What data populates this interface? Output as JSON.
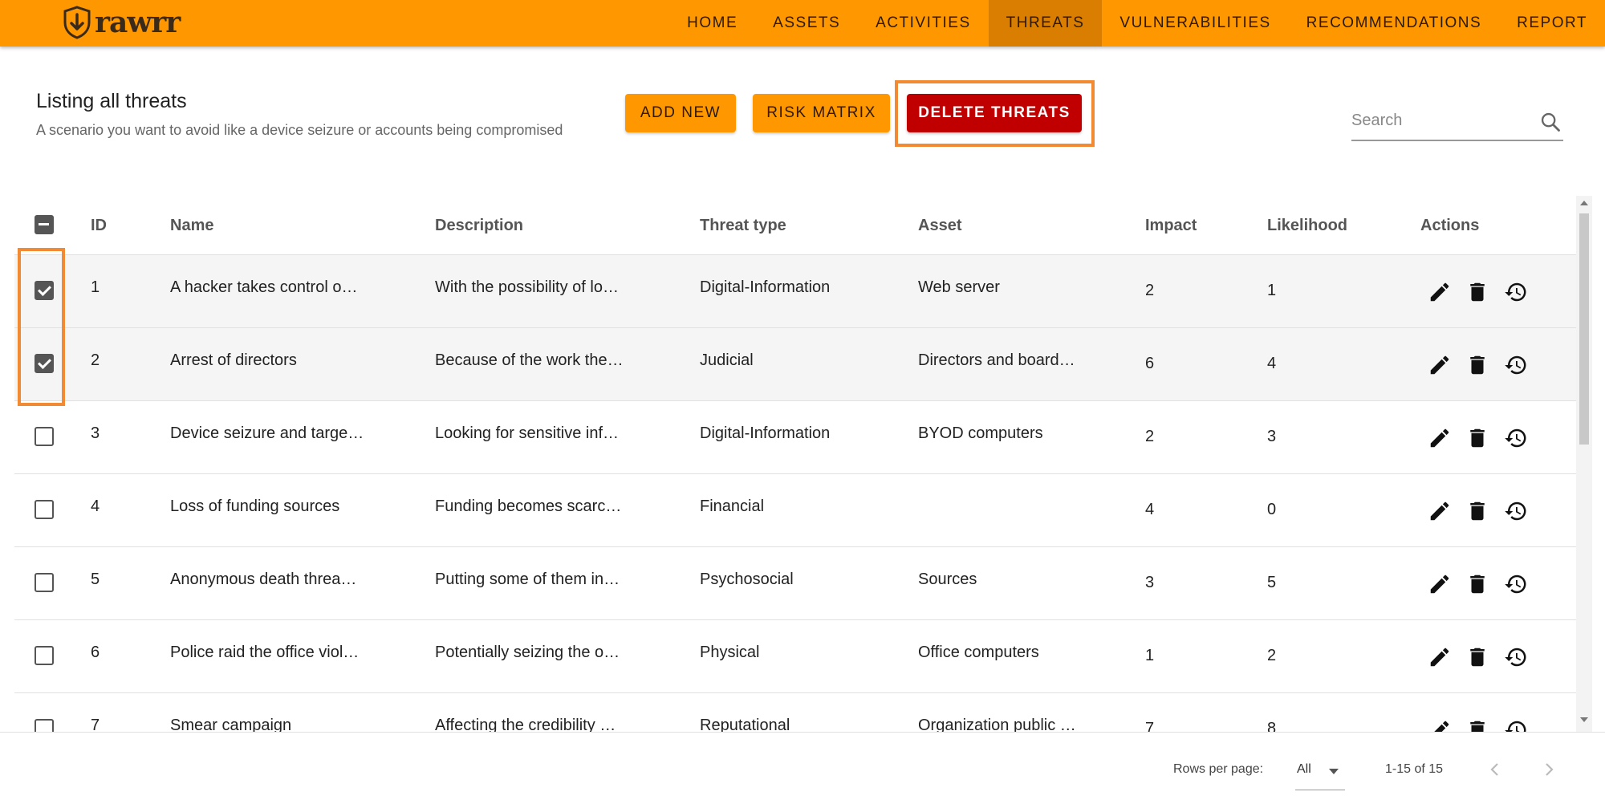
{
  "nav": {
    "logo_text": "rawrr",
    "items": [
      {
        "label": "HOME",
        "active": false
      },
      {
        "label": "ASSETS",
        "active": false
      },
      {
        "label": "ACTIVITIES",
        "active": false
      },
      {
        "label": "THREATS",
        "active": true
      },
      {
        "label": "VULNERABILITIES",
        "active": false
      },
      {
        "label": "RECOMMENDATIONS",
        "active": false
      },
      {
        "label": "REPORT",
        "active": false
      }
    ]
  },
  "header": {
    "title": "Listing all threats",
    "subtitle": "A scenario you want to avoid like a device seizure or accounts being compromised",
    "add_new_label": "ADD NEW",
    "risk_matrix_label": "RISK MATRIX",
    "delete_threats_label": "DELETE THREATS",
    "search_placeholder": "Search"
  },
  "table": {
    "columns": [
      "ID",
      "Name",
      "Description",
      "Threat type",
      "Asset",
      "Impact",
      "Likelihood",
      "Actions"
    ],
    "select_all_state": "indeterminate",
    "rows": [
      {
        "selected": true,
        "id": "1",
        "name": "A hacker takes control o…",
        "description": "With the possibility of lo…",
        "threat_type": "Digital-Information",
        "asset": "Web server",
        "impact": "2",
        "likelihood": "1"
      },
      {
        "selected": true,
        "id": "2",
        "name": "Arrest of directors",
        "description": "Because of the work the…",
        "threat_type": "Judicial",
        "asset": "Directors and board…",
        "impact": "6",
        "likelihood": "4"
      },
      {
        "selected": false,
        "id": "3",
        "name": "Device seizure and targe…",
        "description": "Looking for sensitive inf…",
        "threat_type": "Digital-Information",
        "asset": "BYOD computers",
        "impact": "2",
        "likelihood": "3"
      },
      {
        "selected": false,
        "id": "4",
        "name": "Loss of funding sources",
        "description": "Funding becomes scarc…",
        "threat_type": "Financial",
        "asset": "",
        "impact": "4",
        "likelihood": "0"
      },
      {
        "selected": false,
        "id": "5",
        "name": "Anonymous death threa…",
        "description": "Putting some of them in…",
        "threat_type": "Psychosocial",
        "asset": "Sources",
        "impact": "3",
        "likelihood": "5"
      },
      {
        "selected": false,
        "id": "6",
        "name": "Police raid the office viol…",
        "description": "Potentially seizing the o…",
        "threat_type": "Physical",
        "asset": "Office computers",
        "impact": "1",
        "likelihood": "2"
      },
      {
        "selected": false,
        "id": "7",
        "name": "Smear campaign",
        "description": "Affecting the credibility …",
        "threat_type": "Reputational",
        "asset": "Organization public …",
        "impact": "7",
        "likelihood": "8"
      }
    ]
  },
  "footer": {
    "rows_per_page_label": "Rows per page:",
    "rows_per_page_value": "All",
    "range_label": "1-15 of 15"
  },
  "icons": {
    "edit": "pencil-icon",
    "delete": "trash-icon",
    "history": "history-icon",
    "search": "search-icon",
    "prev": "chevron-left-icon",
    "next": "chevron-right-icon"
  },
  "colors": {
    "nav_bg": "#ff9800",
    "nav_active_bg": "#d97e00",
    "delete_button": "#c00000",
    "highlight": "#f28a33"
  }
}
